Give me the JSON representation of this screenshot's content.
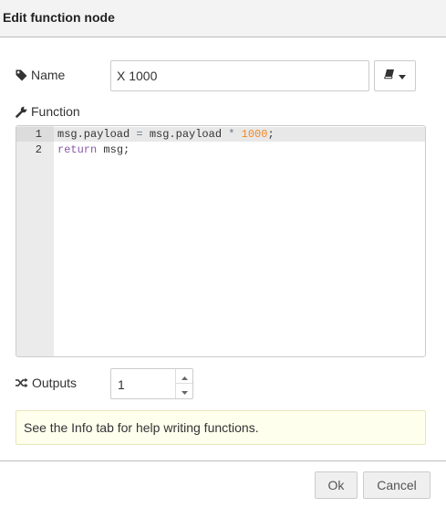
{
  "dialog": {
    "title": "Edit function node"
  },
  "name_field": {
    "label": "Name",
    "value": "X 1000",
    "icon": "tag-icon"
  },
  "library_button": {
    "icon": "book-icon",
    "caret": "caret-down-icon"
  },
  "function_field": {
    "label": "Function",
    "icon": "wrench-icon",
    "lines": [
      {
        "number": "1",
        "tokens": [
          {
            "text": "msg.payload",
            "type": "plain"
          },
          {
            "text": " ",
            "type": "plain"
          },
          {
            "text": "=",
            "type": "op"
          },
          {
            "text": " msg.payload ",
            "type": "plain"
          },
          {
            "text": "*",
            "type": "op"
          },
          {
            "text": " ",
            "type": "plain"
          },
          {
            "text": "1000",
            "type": "num"
          },
          {
            "text": ";",
            "type": "plain"
          }
        ]
      },
      {
        "number": "2",
        "tokens": [
          {
            "text": "return",
            "type": "kw"
          },
          {
            "text": " msg;",
            "type": "plain"
          }
        ]
      }
    ]
  },
  "outputs_field": {
    "label": "Outputs",
    "value": "1",
    "icon": "random-icon"
  },
  "tip": {
    "text": "See the Info tab for help writing functions."
  },
  "buttons": {
    "ok": "Ok",
    "cancel": "Cancel"
  },
  "colors": {
    "keyword": "#8959a8",
    "number": "#f5871f",
    "operator": "#687687",
    "tip_background": "#ffffee"
  }
}
